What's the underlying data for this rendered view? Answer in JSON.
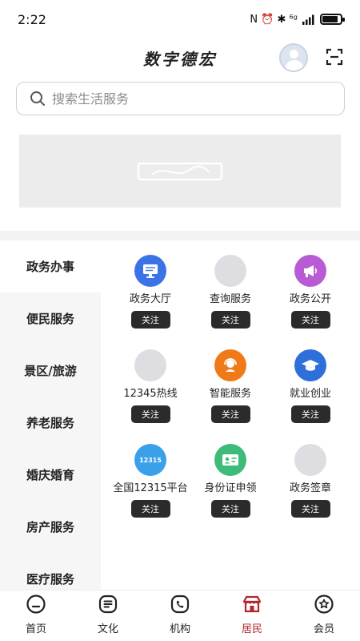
{
  "status_bar": {
    "time": "2:22",
    "indicators": "N ⏰ ✱ ⁶ᵍ"
  },
  "header": {
    "title": "数字德宏",
    "avatar_icon": "user-avatar",
    "scan_icon": "scan-icon"
  },
  "search": {
    "placeholder": "搜索生活服务",
    "value": ""
  },
  "banner": {
    "icon": "image-placeholder-icon"
  },
  "sidebar": {
    "items": [
      {
        "label": "政务办事",
        "active": true
      },
      {
        "label": "便民服务"
      },
      {
        "label": "景区/旅游"
      },
      {
        "label": "养老服务"
      },
      {
        "label": "婚庆婚育"
      },
      {
        "label": "房产服务"
      },
      {
        "label": "医疗服务"
      }
    ]
  },
  "services": {
    "follow_label": "关注",
    "items": [
      {
        "label": "政务大厅",
        "icon": "monitor-icon",
        "color": "#3b73e6"
      },
      {
        "label": "查询服务",
        "icon": "placeholder",
        "color": "#dedde2"
      },
      {
        "label": "政务公开",
        "icon": "megaphone-icon",
        "color": "#b95bd4"
      },
      {
        "label": "12345热线",
        "icon": "placeholder",
        "color": "#dedde2"
      },
      {
        "label": "智能服务",
        "icon": "headset-icon",
        "color": "#f07a1a"
      },
      {
        "label": "就业创业",
        "icon": "graduation-cap-icon",
        "color": "#2f6fd9"
      },
      {
        "label": "全国12315平台",
        "icon": "badge-12315-icon",
        "color": "#3aa0ea",
        "icon_text": "12315"
      },
      {
        "label": "身份证申领",
        "icon": "id-card-icon",
        "color": "#3dbb78"
      },
      {
        "label": "政务签章",
        "icon": "placeholder",
        "color": "#dedde2"
      }
    ]
  },
  "bottom_nav": {
    "accent": "#b3262e",
    "items": [
      {
        "label": "首页",
        "icon": "home-icon"
      },
      {
        "label": "文化",
        "icon": "culture-icon"
      },
      {
        "label": "机构",
        "icon": "institution-icon"
      },
      {
        "label": "居民",
        "icon": "resident-icon",
        "active": true
      },
      {
        "label": "会员",
        "icon": "member-icon"
      }
    ]
  }
}
